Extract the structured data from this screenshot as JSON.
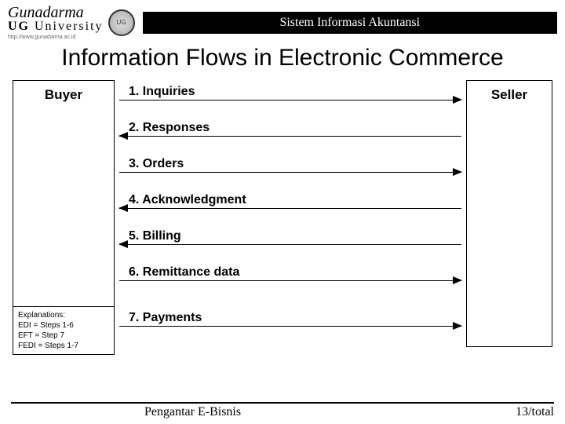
{
  "header": {
    "logo_line1": "Gunadarma",
    "logo_line2": "University",
    "logo_prefix": "UG",
    "tagline": "http://www.gunadarma.ac.id",
    "course_title": "Sistem Informasi Akuntansi"
  },
  "title": "Information Flows in Electronic Commerce",
  "buyer_label": "Buyer",
  "seller_label": "Seller",
  "flows": [
    {
      "label": "1. Inquiries",
      "dir": "right"
    },
    {
      "label": "2. Responses",
      "dir": "left"
    },
    {
      "label": "3. Orders",
      "dir": "right"
    },
    {
      "label": "4. Acknowledgment",
      "dir": "left"
    },
    {
      "label": "5. Billing",
      "dir": "left"
    },
    {
      "label": "6. Remittance data",
      "dir": "right"
    },
    {
      "label": "7. Payments",
      "dir": "right"
    }
  ],
  "explanations": {
    "heading": "Explanations:",
    "lines": [
      "EDI = Steps 1-6",
      "EFT = Step 7",
      "FEDI = Steps 1-7"
    ]
  },
  "footer": {
    "left": "Pengantar E-Bisnis",
    "right": "13/total"
  }
}
